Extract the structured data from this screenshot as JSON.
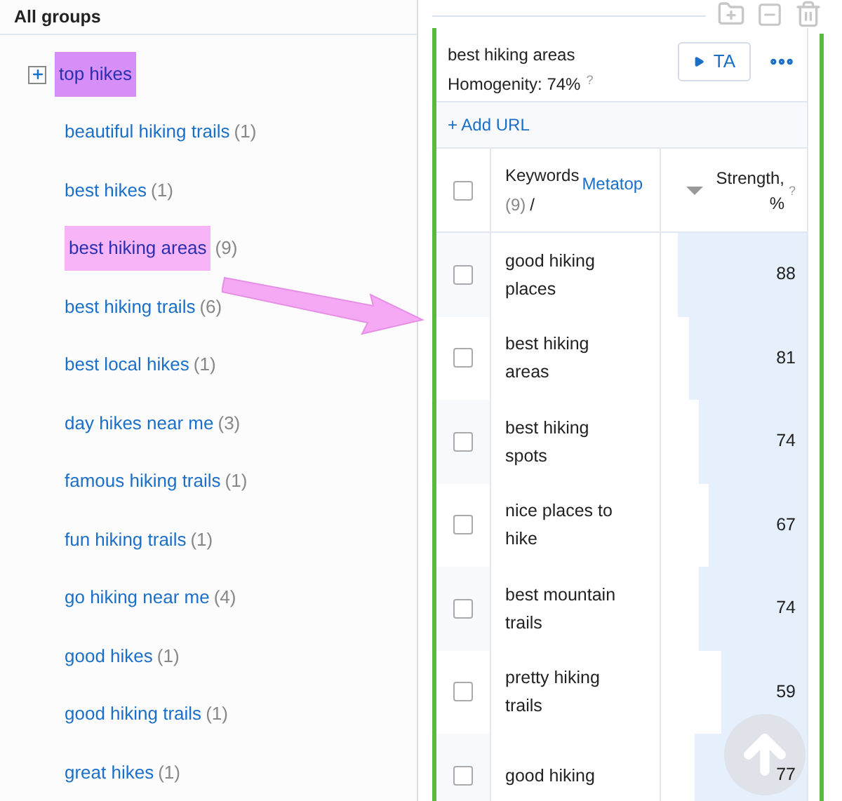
{
  "sidebar": {
    "title": "All groups",
    "root": {
      "label": "top hikes",
      "expanded": false,
      "color": "#d68ff7",
      "children": [
        {
          "label": "beautiful hiking trails",
          "count": "(1)"
        },
        {
          "label": "best hikes",
          "count": "(1)"
        },
        {
          "label": "best hiking areas",
          "count": "(9)",
          "color": "#f7b4f7"
        },
        {
          "label": "best hiking trails",
          "count": "(6)"
        },
        {
          "label": "best local hikes",
          "count": "(1)"
        },
        {
          "label": "day hikes near me",
          "count": "(3)"
        },
        {
          "label": "famous hiking trails",
          "count": "(1)"
        },
        {
          "label": "fun hiking trails",
          "count": "(1)"
        },
        {
          "label": "go hiking near me",
          "count": "(4)"
        },
        {
          "label": "good hikes",
          "count": "(1)"
        },
        {
          "label": "good hiking trails",
          "count": "(1)"
        },
        {
          "label": "great hikes",
          "count": "(1)"
        }
      ]
    }
  },
  "group": {
    "title": "best hiking areas",
    "homogeneity": "Homogenity: 74%",
    "help": "?",
    "ta_button": "TA",
    "add_url": "+ Add URL",
    "select_all": false,
    "columns": {
      "keywords": "Keywords",
      "count": "(9)",
      "slash": "/",
      "metatop": "Metatop",
      "strength": "Strength, %",
      "help": "?"
    },
    "rows": [
      {
        "keyword": "good hiking places",
        "strength": "88",
        "level": 0.88,
        "checked": false
      },
      {
        "keyword": "best hiking areas",
        "strength": "81",
        "level": 0.81,
        "checked": false
      },
      {
        "keyword": "best hiking spots",
        "strength": "74",
        "level": 0.74,
        "checked": false
      },
      {
        "keyword": "nice places to hike",
        "strength": "67",
        "level": 0.67,
        "checked": false
      },
      {
        "keyword": "best mountain trails",
        "strength": "74",
        "level": 0.74,
        "checked": false
      },
      {
        "keyword": "pretty hiking trails",
        "strength": "59",
        "level": 0.59,
        "checked": false
      },
      {
        "keyword": "good hiking",
        "strength": "77",
        "level": 0.77,
        "checked": false
      }
    ]
  }
}
